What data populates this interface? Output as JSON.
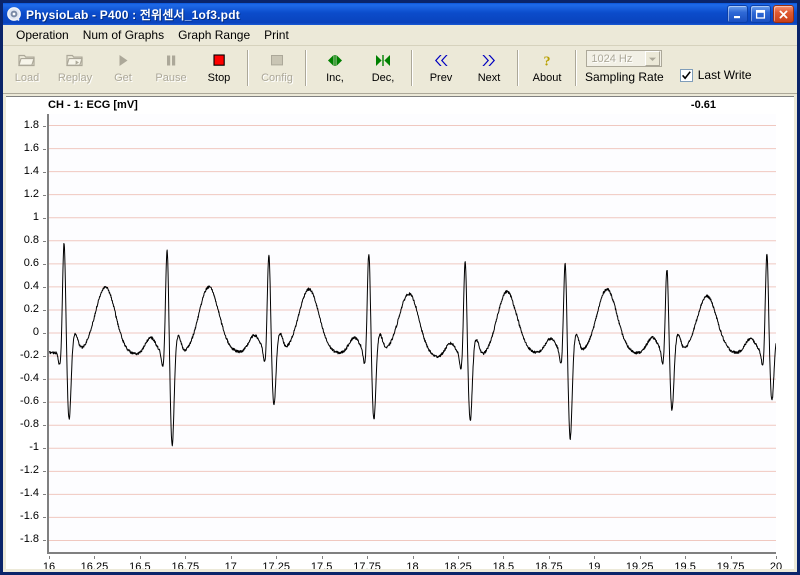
{
  "window": {
    "title": "PhysioLab - P400 : 전위센서_1of3.pdt",
    "icon": "scope-icon",
    "minimize_label": "Minimize",
    "maximize_label": "Maximize",
    "close_label": "Close",
    "titlebar_color": "#0a43bd"
  },
  "menu": {
    "items": [
      {
        "label": "Operation"
      },
      {
        "label": "Num of Graphs"
      },
      {
        "label": "Graph Range"
      },
      {
        "label": "Print"
      }
    ]
  },
  "toolbar": {
    "buttons": [
      {
        "label": "Load",
        "icon": "folder-open-icon",
        "enabled": false
      },
      {
        "label": "Replay",
        "icon": "folder-replay-icon",
        "enabled": false
      },
      {
        "label": "Get",
        "icon": "play-icon",
        "enabled": false
      },
      {
        "label": "Pause",
        "icon": "pause-icon",
        "enabled": false
      },
      {
        "label": "Stop",
        "icon": "stop-icon",
        "enabled": true
      },
      {
        "label": "Config",
        "icon": "config-icon",
        "enabled": false
      },
      {
        "label": "Inc,",
        "icon": "expand-arrows-icon",
        "enabled": true
      },
      {
        "label": "Dec,",
        "icon": "collapse-arrows-icon",
        "enabled": true
      },
      {
        "label": "Prev",
        "icon": "double-chevron-left-icon",
        "enabled": true
      },
      {
        "label": "Next",
        "icon": "double-chevron-right-icon",
        "enabled": true
      },
      {
        "label": "About",
        "icon": "question-mark-icon",
        "enabled": true
      }
    ],
    "sampling_rate": {
      "label": "Sampling Rate",
      "value": "1024 Hz",
      "icon": "chevron-down-icon",
      "enabled": false
    },
    "last_write": {
      "label": "Last Write",
      "checked": true,
      "icon": "checkmark-icon"
    },
    "stop_color": "#ff0000",
    "accent_green": "#008000",
    "accent_blue": "#0000c0"
  },
  "chart_header": {
    "channel_title": "CH - 1:  ECG [mV]",
    "current_value": "-0.61"
  },
  "chart_data": {
    "type": "line",
    "title": "CH - 1:  ECG [mV]",
    "xlabel": "",
    "ylabel": "ECG [mV]",
    "xlim": [
      16,
      20
    ],
    "ylim": [
      -1.9,
      1.9
    ],
    "grid": "horizontal",
    "legend": "none",
    "line_color": "#000000",
    "grid_color": "#f0c8c0",
    "background": "#fdfdff",
    "x_ticks": [
      16,
      16.25,
      16.5,
      16.75,
      17,
      17.25,
      17.5,
      17.75,
      18,
      18.25,
      18.5,
      18.75,
      19,
      19.25,
      19.5,
      19.75,
      20
    ],
    "x_tick_labels": [
      "16",
      "16.25",
      "16.5",
      "16.75",
      "17",
      "17.25",
      "17.5",
      "17.75",
      "18",
      "18.25",
      "18.5",
      "18.75",
      "19",
      "19.25",
      "19.5",
      "19.75",
      "20"
    ],
    "y_ticks": [
      1.8,
      1.6,
      1.4,
      1.2,
      1,
      0.8,
      0.6,
      0.4,
      0.2,
      0,
      -0.2,
      -0.4,
      -0.6,
      -0.8,
      -1,
      -1.2,
      -1.4,
      -1.6,
      -1.8
    ],
    "y_tick_labels": [
      "1.8",
      "1.6",
      "1.4",
      "1.2",
      "1",
      "0.8",
      "0.6",
      "0.4",
      "0.2",
      "0",
      "-0.2",
      "-0.4",
      "-0.6",
      "-0.8",
      "-1",
      "-1.2",
      "-1.4",
      "-1.6",
      "-1.8"
    ],
    "series_name": "ECG",
    "sampling_rate_hz": 1024,
    "beats": [
      {
        "r_time": 16.083,
        "r_amp": 0.79,
        "s_amp": -0.77,
        "t_time": 16.31,
        "t_amp": 0.4,
        "p_time": 16.56,
        "p_amp": 0.15,
        "baseline": -0.17
      },
      {
        "r_time": 16.65,
        "r_amp": 0.73,
        "s_amp": -1.0,
        "t_time": 16.88,
        "t_amp": 0.4,
        "p_time": 17.13,
        "p_amp": 0.15,
        "baseline": -0.19
      },
      {
        "r_time": 17.21,
        "r_amp": 0.69,
        "s_amp": -0.65,
        "t_time": 17.43,
        "t_amp": 0.38,
        "p_time": 17.68,
        "p_amp": 0.14,
        "baseline": -0.17
      },
      {
        "r_time": 17.76,
        "r_amp": 0.7,
        "s_amp": -0.78,
        "t_time": 17.98,
        "t_amp": 0.34,
        "p_time": 18.21,
        "p_amp": 0.13,
        "baseline": -0.18
      },
      {
        "r_time": 18.29,
        "r_amp": 0.63,
        "s_amp": -0.79,
        "t_time": 18.52,
        "t_amp": 0.36,
        "p_time": 18.76,
        "p_amp": 0.13,
        "baseline": -0.22
      },
      {
        "r_time": 18.84,
        "r_amp": 0.61,
        "s_amp": -0.94,
        "t_time": 19.07,
        "t_amp": 0.38,
        "p_time": 19.32,
        "p_amp": 0.14,
        "baseline": -0.18
      },
      {
        "r_time": 19.4,
        "r_amp": 0.56,
        "s_amp": -0.69,
        "t_time": 19.62,
        "t_amp": 0.32,
        "p_time": 19.86,
        "p_amp": 0.13,
        "baseline": -0.18
      },
      {
        "r_time": 19.95,
        "r_amp": 0.69,
        "s_amp": -0.61,
        "t_time": null,
        "t_amp": null,
        "p_time": null,
        "p_amp": null,
        "baseline": -0.18
      }
    ],
    "heart_rate_bpm": 108,
    "notes": "8 QRS complexes visible between t=16s and t=20s; R peaks ~0.56-0.79 mV, S troughs ~-0.61 to -1.00 mV, baseline ~-0.18 mV"
  }
}
